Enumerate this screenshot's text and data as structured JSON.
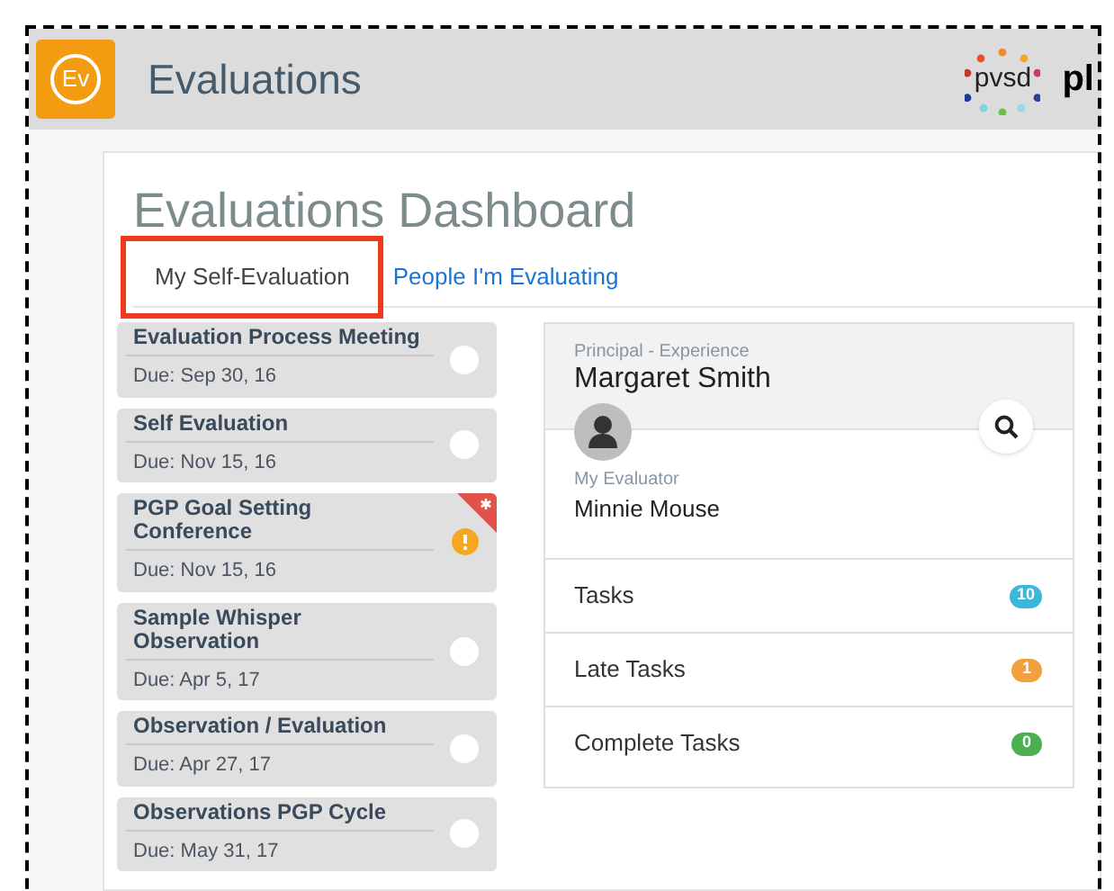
{
  "header": {
    "logo": "Ev",
    "title": "Evaluations",
    "brand": "pvsd",
    "cut_text": "pl"
  },
  "dashboard": {
    "title": "Evaluations Dashboard",
    "tabs": [
      {
        "label": "My Self-Evaluation",
        "selected": true,
        "highlighted": true
      },
      {
        "label": "People I'm Evaluating",
        "selected": false,
        "highlighted": false
      }
    ],
    "tasks": [
      {
        "title": "Evaluation Process Meeting",
        "due": "Due: Sep 30, 16",
        "late": false
      },
      {
        "title": "Self Evaluation",
        "due": "Due: Nov 15, 16",
        "late": false
      },
      {
        "title": "PGP Goal Setting Conference",
        "due": "Due: Nov 15, 16",
        "late": true
      },
      {
        "title": "Sample Whisper Observation",
        "due": "Due: Apr 5, 17",
        "late": false
      },
      {
        "title": "Observation / Evaluation",
        "due": "Due: Apr 27, 17",
        "late": false
      },
      {
        "title": "Observations PGP Cycle",
        "due": "Due: May 31, 17",
        "late": false
      }
    ],
    "profile": {
      "role": "Principal - Experience",
      "name": "Margaret Smith",
      "evaluator_label": "My Evaluator",
      "evaluator": "Minnie Mouse"
    },
    "counts": [
      {
        "label": "Tasks",
        "count": "10",
        "color": "#3bb7db"
      },
      {
        "label": "Late Tasks",
        "count": "1",
        "color": "#f0a03c"
      },
      {
        "label": "Complete Tasks",
        "count": "0",
        "color": "#4caf50"
      }
    ]
  }
}
